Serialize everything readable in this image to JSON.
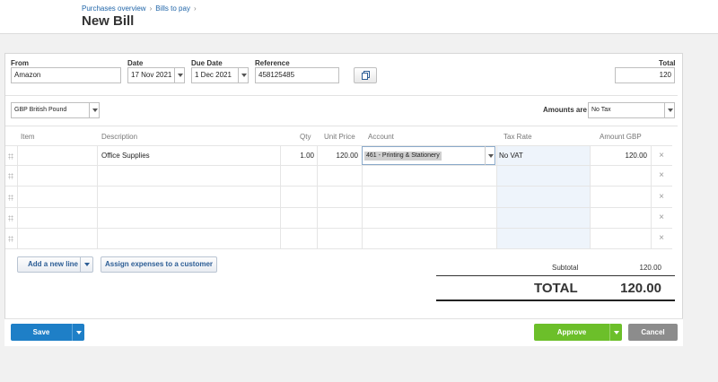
{
  "breadcrumb": {
    "items": [
      "Purchases overview",
      "Bills to pay"
    ],
    "separator": "›"
  },
  "page_title": "New Bill",
  "form": {
    "from_label": "From",
    "from_value": "Amazon",
    "date_label": "Date",
    "date_value": "17 Nov 2021",
    "due_date_label": "Due Date",
    "due_date_value": "1 Dec 2021",
    "reference_label": "Reference",
    "reference_value": "458125485",
    "total_label": "Total",
    "total_value": "120"
  },
  "currency": {
    "value": "GBP British Pound"
  },
  "amounts_are": {
    "label": "Amounts are",
    "value": "No Tax"
  },
  "table": {
    "headers": {
      "item": "Item",
      "description": "Description",
      "qty": "Qty",
      "unit_price": "Unit Price",
      "account": "Account",
      "tax_rate": "Tax Rate",
      "amount": "Amount GBP"
    },
    "rows": [
      {
        "item": "",
        "description": "Office Supplies",
        "qty": "1.00",
        "unit_price": "120.00",
        "account": "461 - Printing & Stationery",
        "tax_rate": "No VAT",
        "amount": "120.00"
      },
      {
        "item": "",
        "description": "",
        "qty": "",
        "unit_price": "",
        "account": "",
        "tax_rate": "",
        "amount": ""
      },
      {
        "item": "",
        "description": "",
        "qty": "",
        "unit_price": "",
        "account": "",
        "tax_rate": "",
        "amount": ""
      },
      {
        "item": "",
        "description": "",
        "qty": "",
        "unit_price": "",
        "account": "",
        "tax_rate": "",
        "amount": ""
      },
      {
        "item": "",
        "description": "",
        "qty": "",
        "unit_price": "",
        "account": "",
        "tax_rate": "",
        "amount": ""
      }
    ],
    "delete_glyph": "×"
  },
  "buttons": {
    "add_line": "Add a new line",
    "assign_expenses": "Assign expenses to a customer",
    "save": "Save",
    "approve": "Approve",
    "cancel": "Cancel"
  },
  "totals": {
    "subtotal_label": "Subtotal",
    "subtotal_value": "120.00",
    "total_label": "TOTAL",
    "total_value": "120.00"
  },
  "colors": {
    "link": "#2166a9",
    "save": "#1e7fc7",
    "approve": "#6cbf2a",
    "cancel": "#8c8c8c"
  },
  "icons": {
    "copy": "copy-icon",
    "dropdown": "chevron-down-icon",
    "delete": "close-icon",
    "drag": "drag-handle-icon"
  }
}
